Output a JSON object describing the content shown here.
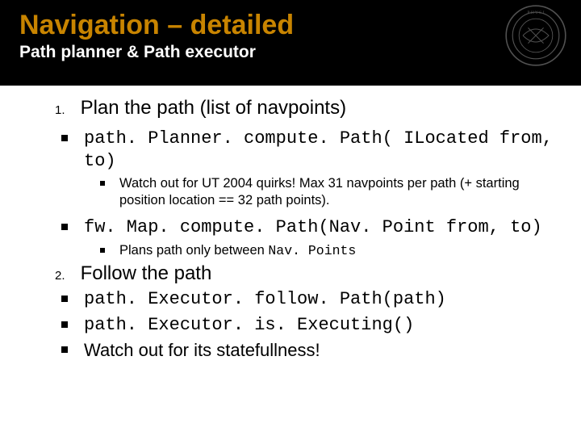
{
  "header": {
    "title": "Navigation – detailed",
    "subtitle": "Path planner & Path executor"
  },
  "items": [
    {
      "num": "1.",
      "text": "Plan the path (list of navpoints)",
      "sub": [
        {
          "code": "path. Planner. compute. Path( ILocated from, to)",
          "notes": [
            {
              "pre": "Watch out for UT 2004 quirks! Max 31 navpoints per path (+ starting position location == 32 path points)."
            }
          ]
        },
        {
          "code": "fw. Map. compute. Path(Nav. Point from, to)",
          "notes": [
            {
              "pre": "Plans path only between ",
              "code": "Nav. Points"
            }
          ]
        }
      ]
    },
    {
      "num": "2.",
      "text": "Follow the path",
      "sub": [
        {
          "code": "path. Executor. follow. Path(path)"
        },
        {
          "code": "path. Executor. is. Executing()"
        },
        {
          "text": "Watch out for its statefullness!"
        }
      ]
    }
  ]
}
